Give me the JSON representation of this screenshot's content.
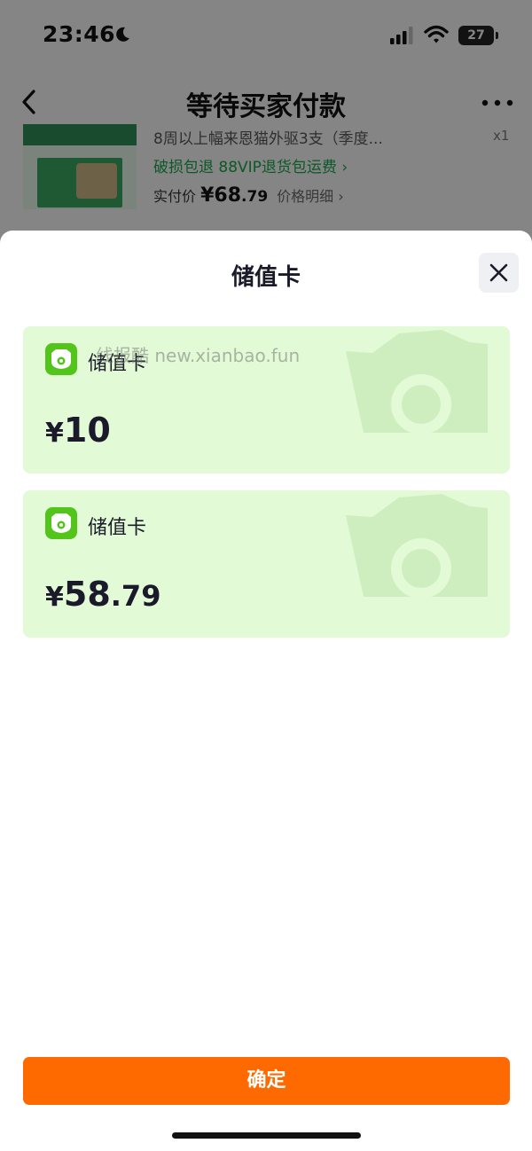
{
  "status_bar": {
    "time": "23:46",
    "battery": "27"
  },
  "nav": {
    "title": "等待买家付款"
  },
  "product": {
    "title": "8周以上幅来恩猫外驱3支（季度...",
    "quantity": "x1",
    "promo": "破损包退  88VIP退货包运费 ›",
    "paid_label": "实付价 ",
    "paid_symbol": "¥",
    "paid_int": "68",
    "paid_dec": ".79",
    "detail_label": "价格明细 ›"
  },
  "sheet": {
    "title": "储值卡",
    "watermark": "线报酷 new.xianbao.fun",
    "cards": [
      {
        "name": "储值卡",
        "symbol": "¥",
        "int": "10",
        "dec": ""
      },
      {
        "name": "储值卡",
        "symbol": "¥",
        "int": "58",
        "dec": ".79"
      }
    ],
    "confirm_label": "确定"
  },
  "colors": {
    "accent": "#ff6a00",
    "card_bg": "#e2fad6",
    "icon_green": "#52c41a",
    "promo_green": "#19a04a"
  }
}
